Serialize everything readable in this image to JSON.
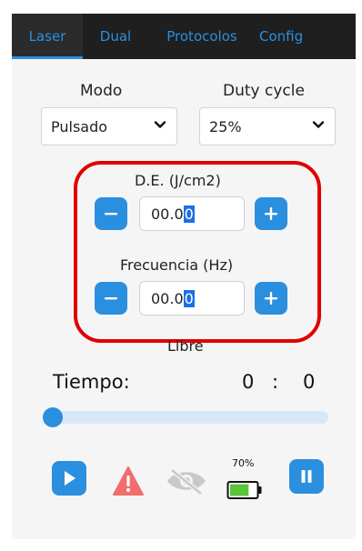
{
  "tabs": [
    {
      "label": "Laser",
      "active": true
    },
    {
      "label": "Dual"
    },
    {
      "label": "Protocolos"
    },
    {
      "label": "Config"
    }
  ],
  "modo": {
    "label": "Modo",
    "value": "Pulsado"
  },
  "duty": {
    "label": "Duty cycle",
    "value": "25%"
  },
  "de": {
    "label": "D.E. (J/cm2)",
    "value_prefix": "00.0",
    "value_selected": "0"
  },
  "frecuencia": {
    "label": "Frecuencia (Hz)",
    "value_prefix": "00.0",
    "value_selected": "0"
  },
  "mode_status": "Libre",
  "tiempo": {
    "label": "Tiempo:",
    "minutes": "0",
    "separator": ":",
    "seconds": "0"
  },
  "slider": {
    "value": 0
  },
  "battery": {
    "percent_label": "70%",
    "level": 0.7
  },
  "colors": {
    "accent": "#2b8fe0",
    "highlight": "#e00000",
    "warning": "#f26d6d",
    "battery": "#5ac43b"
  },
  "icons": [
    "play-icon",
    "warning-icon",
    "eye-slash-icon",
    "battery-icon",
    "pause-icon",
    "chevron-down-icon",
    "minus-icon",
    "plus-icon"
  ]
}
